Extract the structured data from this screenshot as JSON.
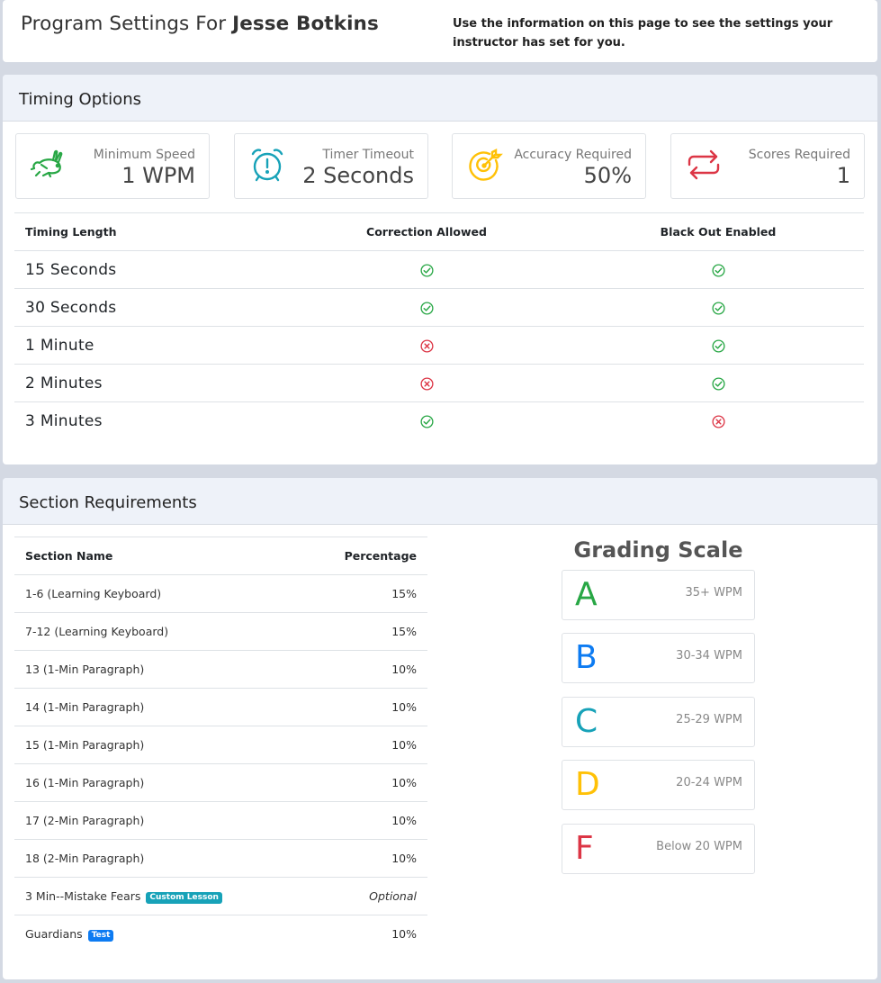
{
  "header": {
    "title_prefix": "Program Settings For",
    "student_name": "Jesse Botkins",
    "info": "Use the information on this page to see the settings your instructor has set for you."
  },
  "timing": {
    "title": "Timing Options",
    "stats": [
      {
        "label": "Minimum Speed",
        "value": "1 WPM",
        "icon": "rabbit-icon",
        "color": "#28a745"
      },
      {
        "label": "Timer Timeout",
        "value": "2 Seconds",
        "icon": "alarm-clock-icon",
        "color": "#17a2b8"
      },
      {
        "label": "Accuracy Required",
        "value": "50%",
        "icon": "target-icon",
        "color": "#ffc107"
      },
      {
        "label": "Scores Required",
        "value": "1",
        "icon": "repeat-icon",
        "color": "#dc3545"
      }
    ],
    "columns": [
      "Timing Length",
      "Correction Allowed",
      "Black Out Enabled"
    ],
    "rows": [
      {
        "length": "15 Seconds",
        "correction": true,
        "blackout": true
      },
      {
        "length": "30 Seconds",
        "correction": true,
        "blackout": true
      },
      {
        "length": "1 Minute",
        "correction": false,
        "blackout": true
      },
      {
        "length": "2 Minutes",
        "correction": false,
        "blackout": true
      },
      {
        "length": "3 Minutes",
        "correction": true,
        "blackout": false
      }
    ]
  },
  "sections": {
    "title": "Section Requirements",
    "columns": [
      "Section Name",
      "Percentage"
    ],
    "rows": [
      {
        "name": "1-6 (Learning Keyboard)",
        "percentage": "15%"
      },
      {
        "name": "7-12 (Learning Keyboard)",
        "percentage": "15%"
      },
      {
        "name": "13 (1-Min Paragraph)",
        "percentage": "10%"
      },
      {
        "name": "14 (1-Min Paragraph)",
        "percentage": "10%"
      },
      {
        "name": "15 (1-Min Paragraph)",
        "percentage": "10%"
      },
      {
        "name": "16 (1-Min Paragraph)",
        "percentage": "10%"
      },
      {
        "name": "17 (2-Min Paragraph)",
        "percentage": "10%"
      },
      {
        "name": "18 (2-Min Paragraph)",
        "percentage": "10%"
      },
      {
        "name": "3 Min--Mistake Fears",
        "percentage": "Optional",
        "badge": "Custom Lesson"
      },
      {
        "name": "Guardians",
        "percentage": "10%",
        "badge": "Test"
      }
    ]
  },
  "grading": {
    "title": "Grading Scale",
    "grades": [
      {
        "letter": "A",
        "range": "35+ WPM",
        "color": "#28a745"
      },
      {
        "letter": "B",
        "range": "30-34 WPM",
        "color": "#0d7bf2"
      },
      {
        "letter": "C",
        "range": "25-29 WPM",
        "color": "#17a2b8"
      },
      {
        "letter": "D",
        "range": "20-24 WPM",
        "color": "#ffc107"
      },
      {
        "letter": "F",
        "range": "Below 20 WPM",
        "color": "#dc3545"
      }
    ]
  },
  "colors": {
    "check": "#28a745",
    "cross": "#dc3545"
  }
}
